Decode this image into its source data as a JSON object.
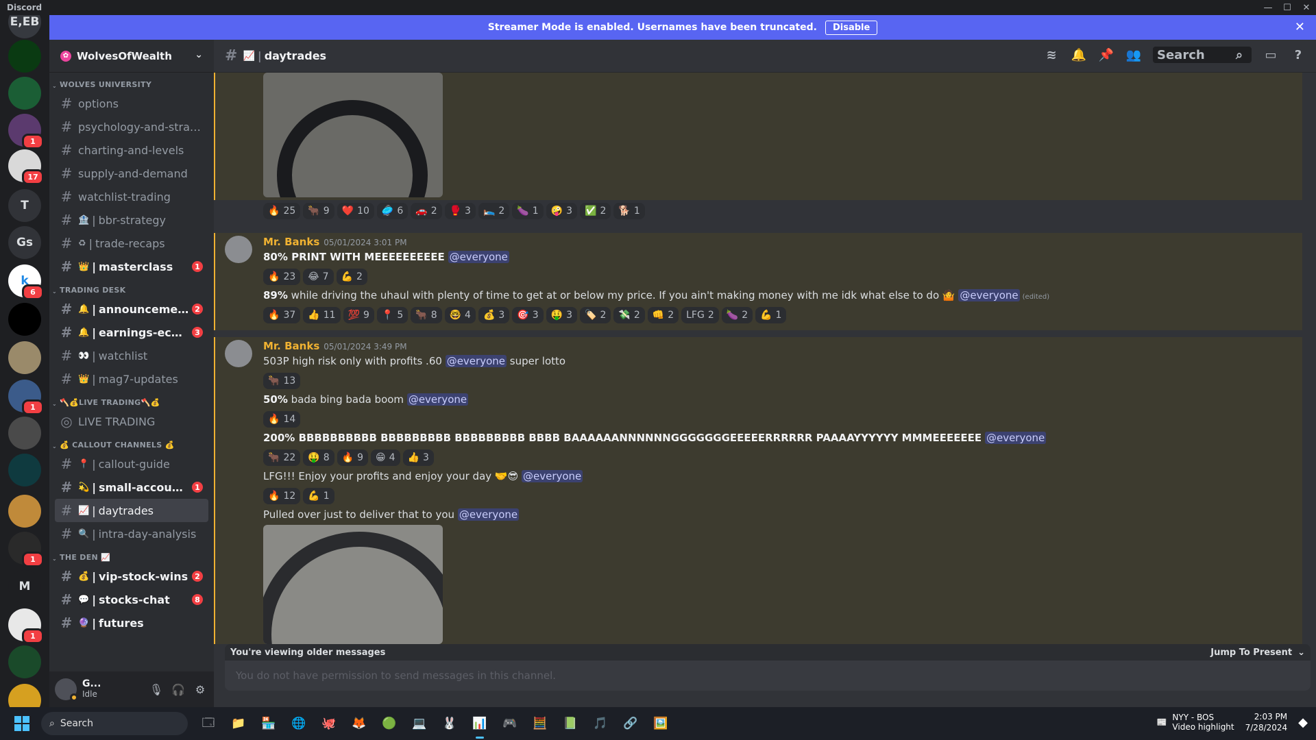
{
  "window": {
    "app_name": "Discord",
    "controls": [
      "—",
      "☐",
      "✕"
    ]
  },
  "banner": {
    "text": "Streamer Mode is enabled. Usernames have been truncated.",
    "button": "Disable",
    "close": "✕"
  },
  "rail": {
    "servers": [
      {
        "label": "E,EB",
        "bg": "#36393f",
        "badge": ""
      },
      {
        "label": "",
        "bg": "#0a3a12",
        "badge": ""
      },
      {
        "label": "",
        "bg": "#1b5e35",
        "badge": ""
      },
      {
        "label": "",
        "bg": "#5b3a6e",
        "badge": "1"
      },
      {
        "label": "",
        "bg": "#d9d9d9",
        "badge": "17"
      },
      {
        "label": "T",
        "bg": "#313338",
        "badge": ""
      },
      {
        "label": "Gs",
        "bg": "#313338",
        "badge": ""
      },
      {
        "label": "k",
        "bg": "#ffffff",
        "badge": "6"
      },
      {
        "label": "",
        "bg": "#000000",
        "badge": ""
      },
      {
        "label": "",
        "bg": "#9a8a6a",
        "badge": ""
      },
      {
        "label": "",
        "bg": "#3b5b8a",
        "badge": "1"
      },
      {
        "label": "",
        "bg": "#4a4a4a",
        "badge": ""
      },
      {
        "label": "",
        "bg": "#0f3a3f",
        "badge": ""
      },
      {
        "label": "",
        "bg": "#c08a3a",
        "badge": ""
      },
      {
        "label": "",
        "bg": "#2a2a2a",
        "badge": "1"
      },
      {
        "label": "M",
        "bg": "#1e1f22",
        "badge": ""
      },
      {
        "label": "",
        "bg": "#e8e8e8",
        "badge": "1"
      },
      {
        "label": "",
        "bg": "#1a4a2a",
        "badge": ""
      },
      {
        "label": "",
        "bg": "#d6a020",
        "badge": ""
      }
    ]
  },
  "guild": {
    "name": "WolvesOfWealth"
  },
  "categories": [
    {
      "name": "WOLVES UNIVERSITY",
      "channels": [
        {
          "emoji": "",
          "name": "options",
          "unread": false,
          "badge": ""
        },
        {
          "emoji": "",
          "name": "psychology-and-strategi...",
          "unread": false,
          "badge": ""
        },
        {
          "emoji": "",
          "name": "charting-and-levels",
          "unread": false,
          "badge": ""
        },
        {
          "emoji": "",
          "name": "supply-and-demand",
          "unread": false,
          "badge": ""
        },
        {
          "emoji": "",
          "name": "watchlist-trading",
          "unread": false,
          "badge": ""
        },
        {
          "emoji": "🏦",
          "name": "bbr-strategy",
          "unread": false,
          "badge": ""
        },
        {
          "emoji": "♻",
          "name": "trade-recaps",
          "unread": false,
          "badge": ""
        },
        {
          "emoji": "👑",
          "name": "masterclass",
          "unread": true,
          "badge": "1"
        }
      ]
    },
    {
      "name": "TRADING DESK",
      "channels": [
        {
          "emoji": "🔔",
          "name": "announcements",
          "unread": true,
          "badge": "2"
        },
        {
          "emoji": "🔔",
          "name": "earnings-econo...",
          "unread": true,
          "badge": "3"
        },
        {
          "emoji": "👀",
          "name": "watchlist",
          "unread": false,
          "badge": ""
        },
        {
          "emoji": "👑",
          "name": "mag7-updates",
          "unread": false,
          "badge": ""
        }
      ]
    },
    {
      "name": "🪓💰LIVE TRADING🪓💰",
      "channels": [
        {
          "emoji": "",
          "name": "LIVE TRADING",
          "unread": false,
          "badge": "",
          "stage": true
        }
      ]
    },
    {
      "name": "💰 CALLOUT CHANNELS 💰",
      "channels": [
        {
          "emoji": "📍",
          "name": "callout-guide",
          "unread": false,
          "badge": ""
        },
        {
          "emoji": "💫",
          "name": "small-account-...",
          "unread": true,
          "badge": "1"
        },
        {
          "emoji": "📈",
          "name": "daytrades",
          "unread": false,
          "badge": "",
          "selected": true
        },
        {
          "emoji": "🔍",
          "name": "intra-day-analysis",
          "unread": false,
          "badge": ""
        }
      ]
    },
    {
      "name": "THE DEN 📈",
      "channels": [
        {
          "emoji": "💰",
          "name": "vip-stock-wins",
          "unread": true,
          "badge": "2"
        },
        {
          "emoji": "💬",
          "name": "stocks-chat",
          "unread": true,
          "badge": "8"
        },
        {
          "emoji": "🔮",
          "name": "futures",
          "unread": true,
          "badge": ""
        }
      ]
    }
  ],
  "user": {
    "name": "G...",
    "status": "Idle"
  },
  "channel_header": {
    "emoji": "📈",
    "name": "daytrades",
    "search_placeholder": "Search"
  },
  "messages": {
    "top_reactions": [
      [
        "🔥",
        "25"
      ],
      [
        "🐂",
        "9"
      ],
      [
        "❤️",
        "10"
      ],
      [
        "🥏",
        "6"
      ],
      [
        "🚗",
        "2"
      ],
      [
        "🥊",
        "3"
      ],
      [
        "🛌",
        "2"
      ],
      [
        "🍆",
        "1"
      ],
      [
        "🤪",
        "3"
      ],
      [
        "✅",
        "2"
      ],
      [
        "🐕",
        "1"
      ]
    ],
    "m1": {
      "author": "Mr. Banks",
      "time": "05/01/2024 3:01 PM",
      "l1_bold": "80% PRINT WITH MEEEEEEEEEE",
      "mention": "@everyone",
      "r1": [
        [
          "🔥",
          "23"
        ],
        [
          "😂",
          "7"
        ],
        [
          "💪",
          "2"
        ]
      ],
      "l2_bold": "89%",
      "l2_text": " while driving the uhaul with plenty of time to get at or below my price. If you ain't making money with me idk what else  to do 🤷",
      "edited": "(edited)",
      "r2": [
        [
          "🔥",
          "37"
        ],
        [
          "👍",
          "11"
        ],
        [
          "💯",
          "9"
        ],
        [
          "📍",
          "5"
        ],
        [
          "🐂",
          "8"
        ],
        [
          "🤓",
          "4"
        ],
        [
          "💰",
          "3"
        ],
        [
          "🎯",
          "3"
        ],
        [
          "🤑",
          "3"
        ],
        [
          "🏷️",
          "2"
        ],
        [
          "💸",
          "2"
        ],
        [
          "👊",
          "2"
        ],
        [
          "LFG",
          "2"
        ],
        [
          "🍆",
          "2"
        ],
        [
          "💪",
          "1"
        ]
      ]
    },
    "m2": {
      "author": "Mr. Banks",
      "time": "05/01/2024 3:49 PM",
      "l1": "503P high risk only with profits .60",
      "l1_after": " super lotto",
      "r1": [
        [
          "🐂",
          "13"
        ]
      ],
      "l2_bold": "50%",
      "l2_text": " bada bing bada boom",
      "r2": [
        [
          "🔥",
          "14"
        ]
      ],
      "l3_bold": "200% BBBBBBBBBB BBBBBBBBB BBBBBBBBB BBBB BAAAAAANNNNNNGGGGGGGEEEEERRRRRR PAAAAYYYYYY MMMEEEEEEE",
      "r3": [
        [
          "🐂",
          "22"
        ],
        [
          "🤑",
          "8"
        ],
        [
          "🔥",
          "9"
        ],
        [
          "😁",
          "4"
        ],
        [
          "👍",
          "3"
        ]
      ],
      "l4": "LFG!!! Enjoy your profits and enjoy your day 🤝😎",
      "r4": [
        [
          "🔥",
          "12"
        ],
        [
          "💪",
          "1"
        ]
      ],
      "l5": "Pulled over just to deliver that to you"
    }
  },
  "older": {
    "text": "You're viewing older messages",
    "jump": "Jump To Present"
  },
  "composer": {
    "placeholder": "You do not have permission to send messages in this channel."
  },
  "taskbar": {
    "search": "Search",
    "news_title": "NYY - BOS",
    "news_sub": "Video highlight",
    "time": "2:03 PM",
    "date": "7/28/2024",
    "apps": [
      "🗔",
      "📁",
      "🏪",
      "🌐",
      "🐙",
      "🦊",
      "🟢",
      "💻",
      "🐰",
      "📊",
      "🎮",
      "🧮",
      "📗",
      "🎵",
      "🔗",
      "🖼️"
    ]
  }
}
